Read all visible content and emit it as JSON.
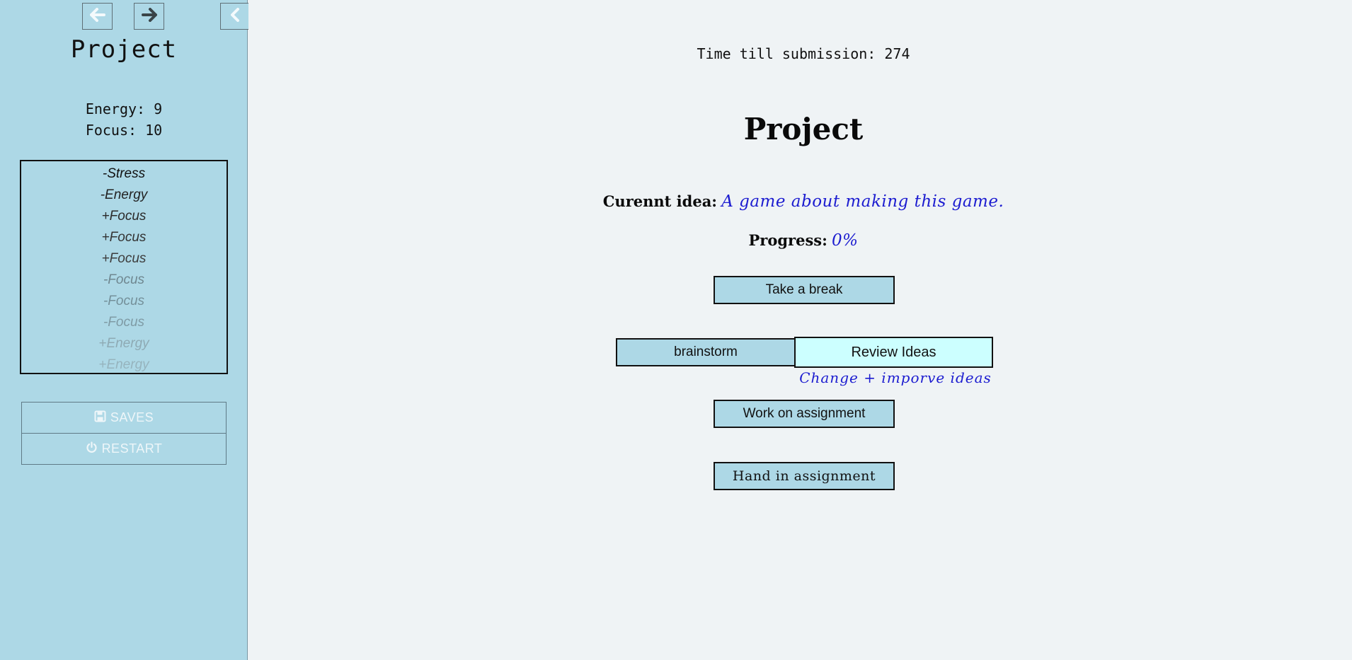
{
  "sidebar": {
    "title": "Project",
    "stats": [
      {
        "label": "Energy: 9"
      },
      {
        "label": "Focus: 10"
      }
    ],
    "log": [
      {
        "text": "-Stress",
        "color": "#111111"
      },
      {
        "text": "-Energy",
        "color": "#222222"
      },
      {
        "text": "+Focus",
        "color": "#2b2b2b"
      },
      {
        "text": "+Focus",
        "color": "#333333"
      },
      {
        "text": "+Focus",
        "color": "#3d3d3d"
      },
      {
        "text": "-Focus",
        "color": "#6f8790"
      },
      {
        "text": "-Focus",
        "color": "#74909a"
      },
      {
        "text": "-Focus",
        "color": "#7f9ba5"
      },
      {
        "text": "+Energy",
        "color": "#8eaab4"
      },
      {
        "text": "+Energy",
        "color": "#96b4be"
      }
    ],
    "saves_label": "SAVES",
    "restart_label": "RESTART",
    "icons": {
      "back": "arrow-left-icon",
      "forward": "arrow-right-icon",
      "collapse": "chevron-left-icon",
      "saves": "floppy-disk-icon",
      "restart": "power-icon"
    }
  },
  "main": {
    "timer": "Time till submission: 274",
    "title": "Project",
    "idea_label": "Curennt idea:",
    "idea_value": "A game about making this game.",
    "progress_label": "Progress:",
    "progress_value": "0%",
    "choices": {
      "take_break": "Take a break",
      "brainstorm": "brainstorm",
      "review_ideas": "Review Ideas",
      "work_on_assignment": "Work on assignment",
      "hand_in_assignment": "Hand in assignment"
    },
    "review_tooltip": "Change + imporve ideas"
  },
  "colors": {
    "sidebar_bg": "#add8e6",
    "page_bg": "#eff3f5",
    "button_bg": "#add8e6",
    "hover_button_bg": "#ccffff",
    "handwriting": "#1c1cd0"
  }
}
